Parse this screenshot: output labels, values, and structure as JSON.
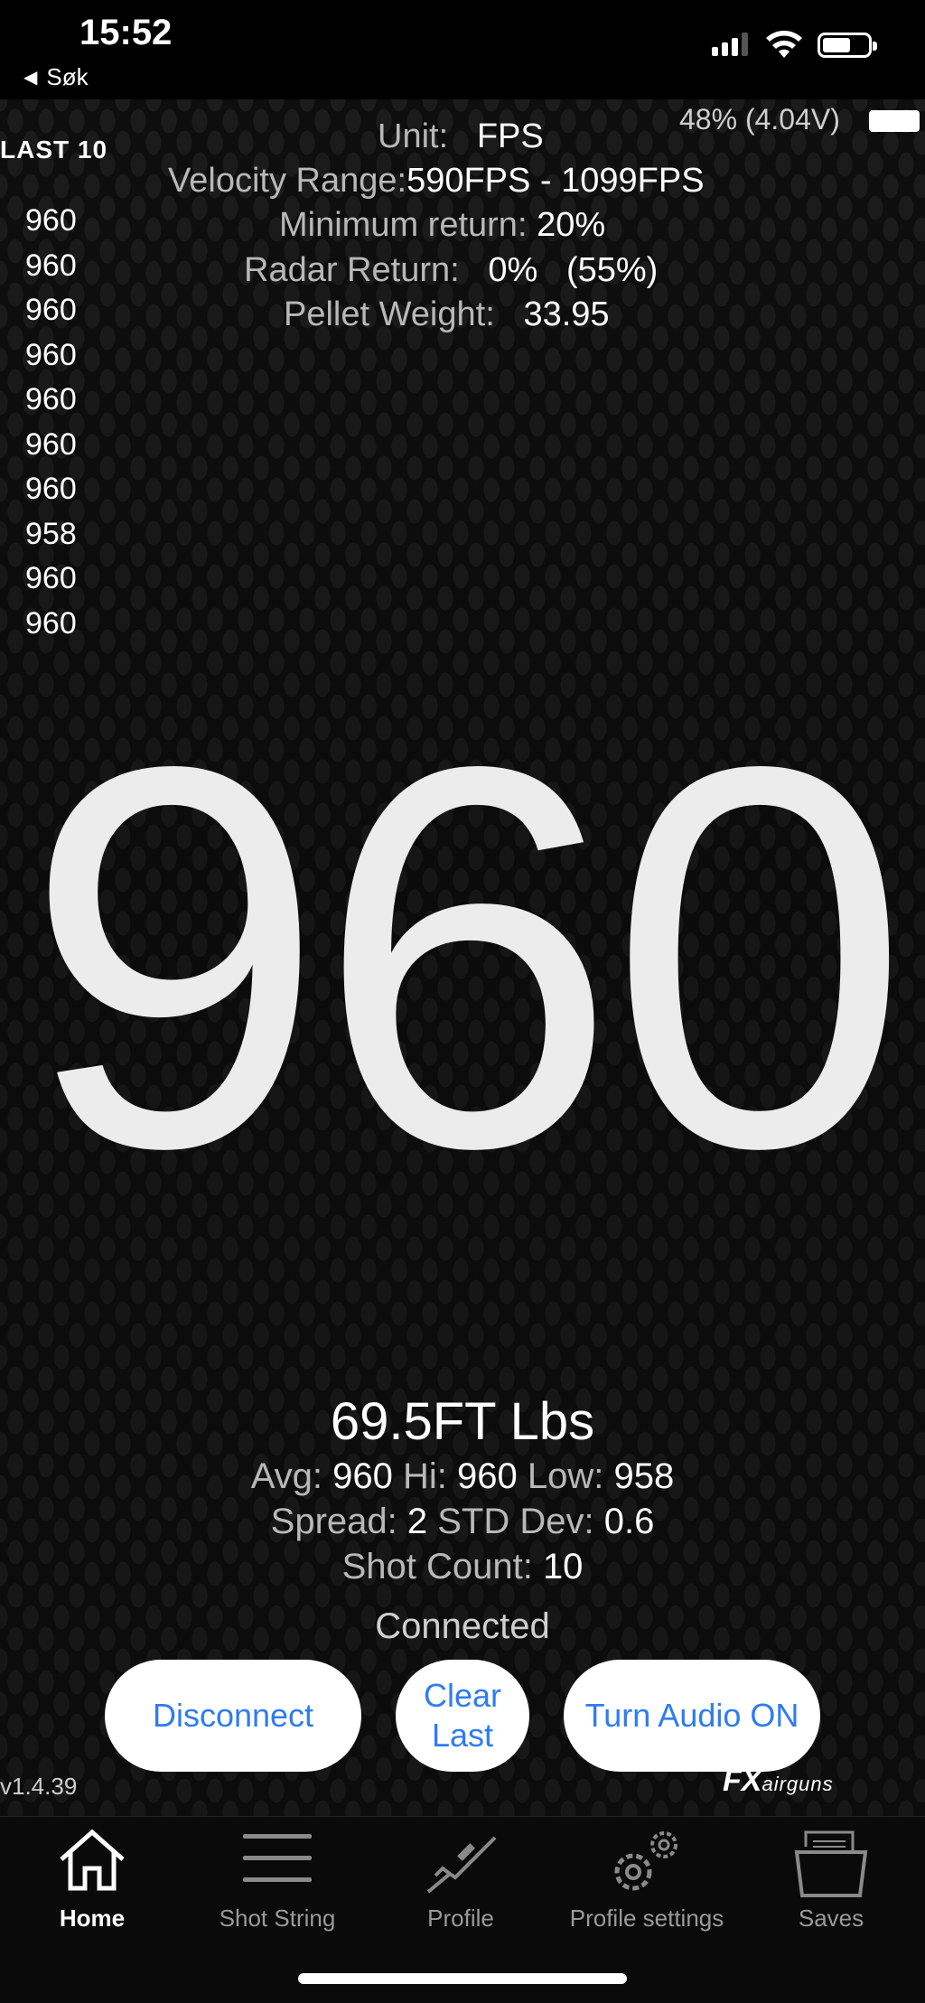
{
  "status_bar": {
    "time": "15:52",
    "back_label": "Søk"
  },
  "device_battery": "48% (4.04V)",
  "last10": {
    "title": "LAST 10",
    "values": [
      "960",
      "960",
      "960",
      "960",
      "960",
      "960",
      "960",
      "958",
      "960",
      "960"
    ]
  },
  "info": {
    "unit_label": "Unit:",
    "unit_value": "FPS",
    "velocity_range_label": "Velocity Range:",
    "velocity_range_value": "590FPS - 1099FPS",
    "min_return_label": "Minimum return:",
    "min_return_value": "20%",
    "radar_return_label": "Radar Return:",
    "radar_return_value": "0%",
    "radar_return_extra": "(55%)",
    "pellet_weight_label": "Pellet Weight:",
    "pellet_weight_value": "33.95"
  },
  "velocity": "960",
  "stats": {
    "energy": "69.5FT Lbs",
    "avg_label": "Avg:",
    "avg_value": "960",
    "hi_label": "Hi:",
    "hi_value": "960",
    "low_label": "Low:",
    "low_value": "958",
    "spread_label": "Spread:",
    "spread_value": "2",
    "std_label": "STD Dev:",
    "std_value": "0.6",
    "count_label": "Shot Count:",
    "count_value": "10"
  },
  "connection_status": "Connected",
  "buttons": {
    "disconnect": "Disconnect",
    "clear_line1": "Clear",
    "clear_line2": "Last",
    "audio": "Turn Audio ON"
  },
  "version": "v1.4.39",
  "logo": {
    "brand": "FX",
    "sub": "airguns"
  },
  "tabs": [
    {
      "label": "Home",
      "icon": "home-icon"
    },
    {
      "label": "Shot String",
      "icon": "list-icon"
    },
    {
      "label": "Profile",
      "icon": "rifle-icon"
    },
    {
      "label": "Profile settings",
      "icon": "gear-icon"
    },
    {
      "label": "Saves",
      "icon": "folder-icon"
    }
  ],
  "colors": {
    "button_text": "#2f7cf0",
    "background": "#000000",
    "pattern": "#1d1d1d"
  }
}
